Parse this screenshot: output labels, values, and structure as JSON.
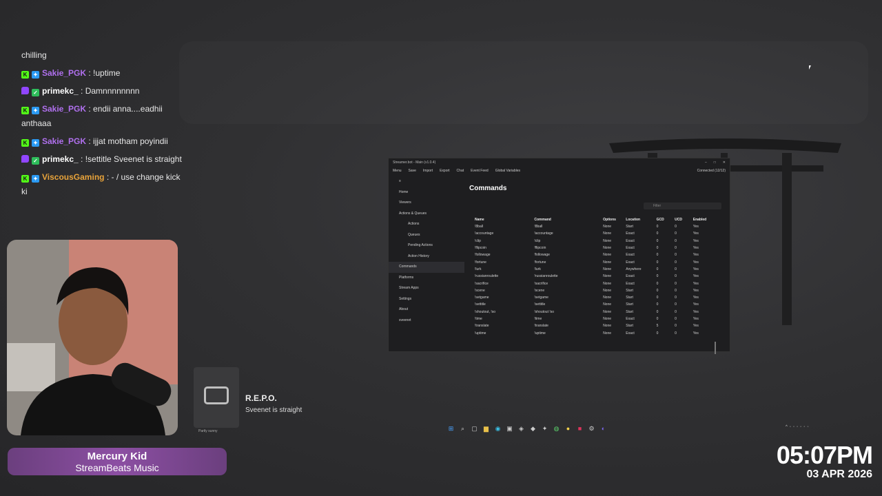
{
  "chat": {
    "top_text": "chilling",
    "messages": [
      {
        "platform": "kick",
        "user": "Sakie_PGK",
        "user_color": "#b070ee",
        "text": " : !uptime"
      },
      {
        "platform": "twitch",
        "user": "primekc_",
        "user_color": "#ffffff",
        "text": " : Damnnnnnnnn"
      },
      {
        "platform": "kick",
        "user": "Sakie_PGK",
        "user_color": "#b070ee",
        "text": " : endii anna....eadhii anthaaa"
      },
      {
        "platform": "kick",
        "user": "Sakie_PGK",
        "user_color": "#b070ee",
        "text": " : ijjat motham poyindii"
      },
      {
        "platform": "twitch",
        "user": "primekc_",
        "user_color": "#ffffff",
        "text": " : !settitle Sveenet is straight"
      },
      {
        "platform": "kick",
        "user": "ViscousGaming",
        "user_color": "#e8a33a",
        "text": " : - / use change kick ki"
      }
    ]
  },
  "music": {
    "title": "Mercury Kid",
    "subtitle": "StreamBeats Music"
  },
  "game": {
    "title": "R.E.P.O.",
    "subtitle": "Sveenet is straight",
    "tiny_label": "Partly sunny"
  },
  "clock": {
    "time": "05:07PM",
    "date": "03 APR 2026"
  },
  "app": {
    "title": "Streamer.bot - Main (v1.0.4)",
    "toolbar": [
      "Menu",
      "Save",
      "Import",
      "Export",
      "Chat",
      "Event Feed",
      "Global Variables"
    ],
    "connection": "Connected (12/12)",
    "sidebar": [
      {
        "label": "Home",
        "sub": false
      },
      {
        "label": "Viewers",
        "sub": false
      },
      {
        "label": "Actions & Queues",
        "sub": false
      },
      {
        "label": "Actions",
        "sub": true
      },
      {
        "label": "Queues",
        "sub": true
      },
      {
        "label": "Pending Actions",
        "sub": true
      },
      {
        "label": "Action History",
        "sub": true
      },
      {
        "label": "Commands",
        "sub": false,
        "selected": true
      },
      {
        "label": "Platforms",
        "sub": false
      },
      {
        "label": "Stream Apps",
        "sub": false
      },
      {
        "label": "Settings",
        "sub": false
      },
      {
        "label": "About",
        "sub": false
      },
      {
        "label": "sveenet",
        "sub": false
      }
    ],
    "heading": "Commands",
    "filter_placeholder": "Filter",
    "columns": [
      "Name",
      "Command",
      "Options",
      "Location",
      "GCD",
      "UCD",
      "Enabled"
    ],
    "rows": [
      [
        "!8ball",
        "!8ball",
        "None",
        "Start",
        "0",
        "0",
        "Yes"
      ],
      [
        "!accountage",
        "!accountage",
        "None",
        "Exact",
        "0",
        "0",
        "Yes"
      ],
      [
        "!clip",
        "!clip",
        "None",
        "Exact",
        "0",
        "0",
        "Yes"
      ],
      [
        "!flipcoin",
        "!flipcoin",
        "None",
        "Exact",
        "0",
        "0",
        "Yes"
      ],
      [
        "!followage",
        "!followage",
        "None",
        "Exact",
        "0",
        "0",
        "Yes"
      ],
      [
        "!fortune",
        "!fortune",
        "None",
        "Exact",
        "0",
        "0",
        "Yes"
      ],
      [
        "!lurk",
        "!lurk",
        "None",
        "Anywhere",
        "0",
        "0",
        "Yes"
      ],
      [
        "!russianroulette",
        "!russianroulette",
        "None",
        "Exact",
        "0",
        "0",
        "Yes"
      ],
      [
        "!sacrifice",
        "!sacrifice",
        "None",
        "Exact",
        "0",
        "0",
        "Yes"
      ],
      [
        "!scene",
        "!scene",
        "None",
        "Start",
        "0",
        "0",
        "Yes"
      ],
      [
        "!setgame",
        "!setgame",
        "None",
        "Start",
        "0",
        "0",
        "Yes"
      ],
      [
        "!settitle",
        "!settitle",
        "None",
        "Start",
        "0",
        "0",
        "Yes"
      ],
      [
        "!shoutout, !so",
        "!shoutout !so",
        "None",
        "Start",
        "0",
        "0",
        "Yes"
      ],
      [
        "!time",
        "!time",
        "None",
        "Exact",
        "0",
        "0",
        "Yes"
      ],
      [
        "!translate",
        "!translate",
        "None",
        "Start",
        "5",
        "0",
        "Yes"
      ],
      [
        "!uptime",
        "!uptime",
        "None",
        "Exact",
        "0",
        "0",
        "Yes"
      ]
    ]
  }
}
